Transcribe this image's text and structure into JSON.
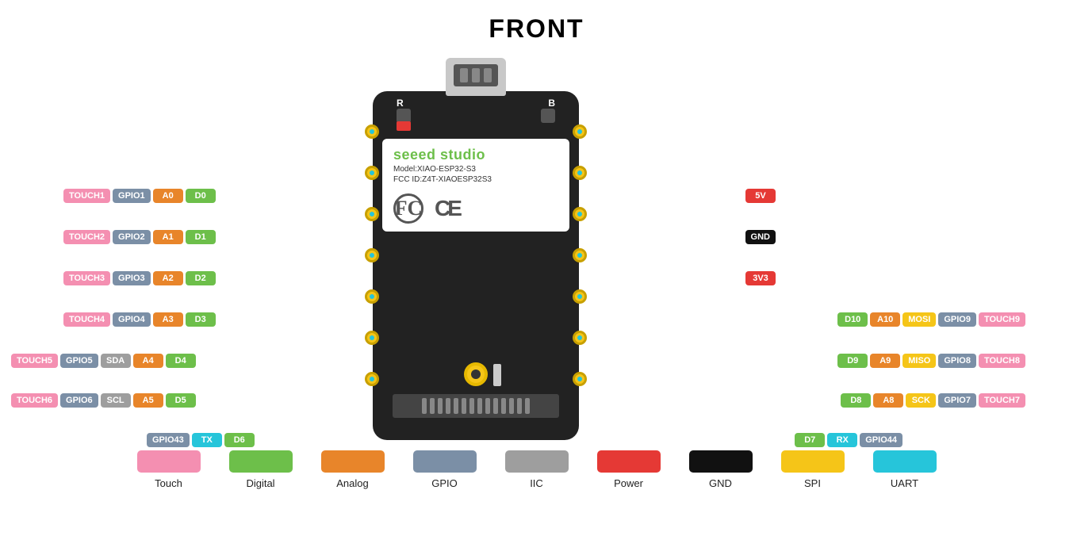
{
  "title": "FRONT",
  "colors": {
    "touch": "#f48fb1",
    "gpio": "#7b8fa6",
    "analog": "#e8852a",
    "digital": "#6dbf4a",
    "power": "#e53935",
    "gnd": "#111111",
    "iic": "#9e9e9e",
    "spi": "#f5c518",
    "uart": "#26c5da"
  },
  "board": {
    "brand1": "seeed",
    "brand2": " studio",
    "model": "Model:XIAO-ESP32-S3",
    "fcc": "FCC ID:Z4T-XIAOESP32S3"
  },
  "left_pins": [
    {
      "touch": "TOUCH1",
      "gpio": "GPIO1",
      "analog": "A0",
      "digital": "D0"
    },
    {
      "touch": "TOUCH2",
      "gpio": "GPIO2",
      "analog": "A1",
      "digital": "D1"
    },
    {
      "touch": "TOUCH3",
      "gpio": "GPIO3",
      "analog": "A2",
      "digital": "D2"
    },
    {
      "touch": "TOUCH4",
      "gpio": "GPIO4",
      "analog": "A3",
      "digital": "D3"
    },
    {
      "touch": "TOUCH5",
      "gpio": "GPIO5",
      "iic": "SDA",
      "analog": "A4",
      "digital": "D4"
    },
    {
      "touch": "TOUCH6",
      "gpio": "GPIO6",
      "iic": "SCL",
      "analog": "A5",
      "digital": "D5"
    },
    {
      "gpio": "GPIO43",
      "uart": "TX",
      "digital": "D6"
    }
  ],
  "right_pins": [
    {
      "power": "5V"
    },
    {
      "gnd": "GND"
    },
    {
      "power": "3V3"
    },
    {
      "digital": "D10",
      "analog": "A10",
      "spi": "MOSI",
      "gpio": "GPIO9",
      "touch": "TOUCH9"
    },
    {
      "digital": "D9",
      "analog": "A9",
      "spi": "MISO",
      "gpio": "GPIO8",
      "touch": "TOUCH8"
    },
    {
      "digital": "D8",
      "analog": "A8",
      "spi": "SCK",
      "gpio": "GPIO7",
      "touch": "TOUCH7"
    },
    {
      "digital": "D7",
      "uart": "RX",
      "gpio": "GPIO44"
    }
  ],
  "legend": [
    {
      "label": "Touch",
      "color": "#f48fb1"
    },
    {
      "label": "Digital",
      "color": "#6dbf4a"
    },
    {
      "label": "Analog",
      "color": "#e8852a"
    },
    {
      "label": "GPIO",
      "color": "#7b8fa6"
    },
    {
      "label": "IIC",
      "color": "#9e9e9e"
    },
    {
      "label": "Power",
      "color": "#e53935"
    },
    {
      "label": "GND",
      "color": "#111111"
    },
    {
      "label": "SPI",
      "color": "#f5c518"
    },
    {
      "label": "UART",
      "color": "#26c5da"
    }
  ]
}
